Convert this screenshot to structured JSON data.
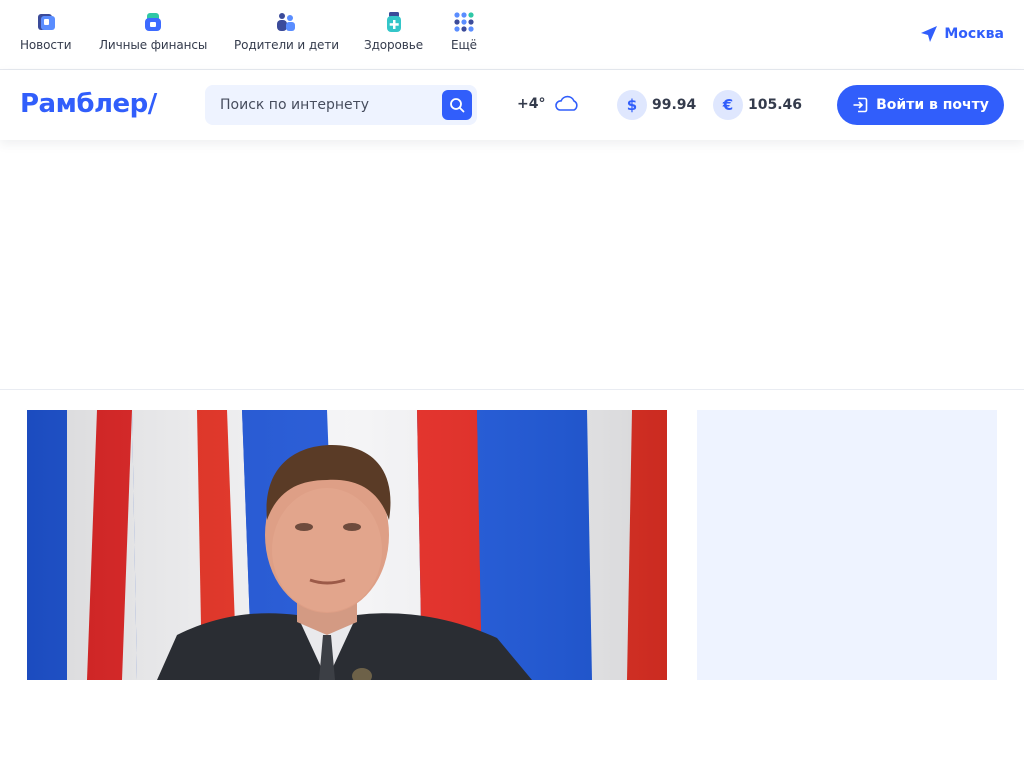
{
  "topnav": {
    "items": [
      {
        "label": "Новости",
        "icon": "news-icon"
      },
      {
        "label": "Личные финансы",
        "icon": "finance-icon"
      },
      {
        "label": "Родители и дети",
        "icon": "family-icon"
      },
      {
        "label": "Здоровье",
        "icon": "health-icon"
      },
      {
        "label": "Ещё",
        "icon": "apps-grid-icon"
      }
    ],
    "geo": {
      "label": "Москва",
      "icon": "location-arrow-icon"
    }
  },
  "header": {
    "logo": "Рамблер/",
    "search": {
      "placeholder": "Поиск по интернету",
      "icon": "search-icon"
    },
    "weather": {
      "temperature": "+4°",
      "icon": "cloud-icon"
    },
    "rates": [
      {
        "symbol": "$",
        "value": "99.94",
        "currency": "usd"
      },
      {
        "symbol": "€",
        "value": "105.46",
        "currency": "eur"
      }
    ],
    "login": {
      "label": "Войти в почту",
      "icon": "login-icon"
    }
  },
  "colors": {
    "accent": "#315efb",
    "text": "#343b4c",
    "search_bg": "#eef3ff",
    "rate_badge_bg": "#dfe7fe"
  }
}
